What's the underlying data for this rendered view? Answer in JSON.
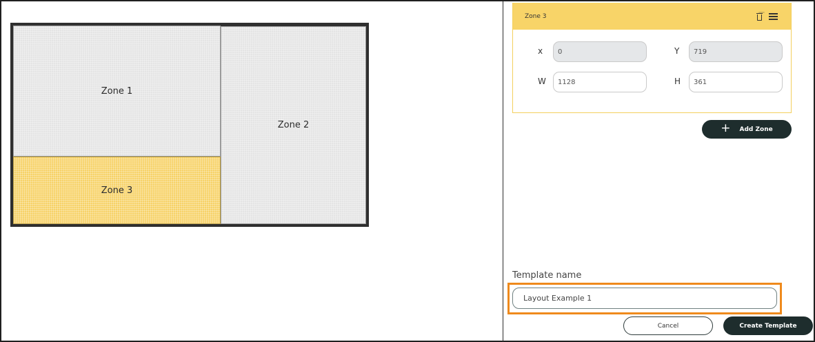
{
  "preview": {
    "zones": [
      {
        "label": "Zone 1"
      },
      {
        "label": "Zone 2"
      },
      {
        "label": "Zone 3",
        "selected": true
      }
    ]
  },
  "zone_editor": {
    "title": "Zone 3",
    "icons": [
      "trash-icon",
      "menu-icon"
    ],
    "fields": {
      "x": {
        "label": "x",
        "value": "0"
      },
      "y": {
        "label": "Y",
        "value": "719"
      },
      "w": {
        "label": "W",
        "value": "1128"
      },
      "h": {
        "label": "H",
        "value": "361"
      }
    }
  },
  "actions": {
    "add_zone": "Add Zone",
    "cancel": "Cancel",
    "create_template": "Create Template"
  },
  "template": {
    "label": "Template name",
    "value": "Layout Example 1"
  },
  "colors": {
    "selected_zone": "#f7d267",
    "header_yellow": "#f8d468",
    "primary_button": "#1e2d2d",
    "highlight_orange": "#ef8a1c",
    "zone_grey": "#e4e4e4"
  }
}
